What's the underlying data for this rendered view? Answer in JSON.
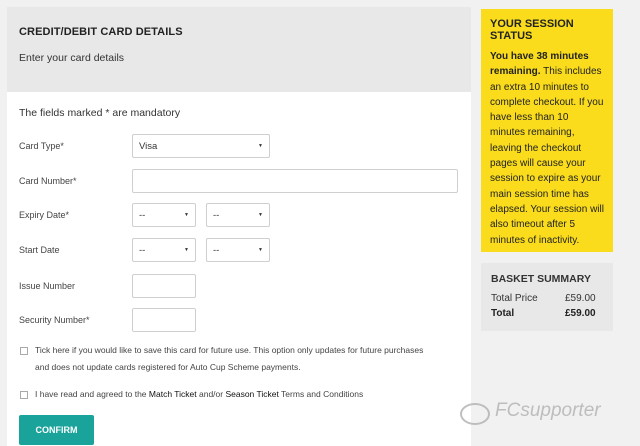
{
  "card": {
    "title": "CREDIT/DEBIT CARD DETAILS",
    "subtitle": "Enter your card details",
    "mandatory_note": "The fields marked * are mandatory",
    "card_type_label": "Card Type*",
    "card_type_value": "Visa",
    "card_number_label": "Card Number*",
    "expiry_label": "Expiry Date*",
    "expiry_month": "--",
    "expiry_year": "--",
    "start_label": "Start Date",
    "start_month": "--",
    "start_year": "--",
    "issue_label": "Issue Number",
    "security_label": "Security Number*",
    "save_card_text_line1": "Tick here if you would like to save this card for future use. This option only updates for future purchases",
    "save_card_text_line2": "and does not update cards registered for Auto Cup Scheme payments.",
    "terms_prefix": "I have read and agreed to the ",
    "terms_link1": "Match Ticket",
    "terms_mid": " and/or ",
    "terms_link2": "Season Ticket",
    "terms_suffix": " Terms and Conditions",
    "confirm_label": "CONFIRM"
  },
  "session": {
    "title": "YOUR SESSION STATUS",
    "bold_text": "You have 38 minutes remaining.",
    "body_text": " This includes an extra 10 minutes to complete checkout. If you have less than 10 minutes remaining, leaving the checkout pages will cause your session to expire as your main session time has elapsed. Your session will also timeout after 5 minutes of inactivity."
  },
  "basket": {
    "title": "BASKET SUMMARY",
    "total_price_label": "Total Price",
    "total_price_value": "£59.00",
    "total_label": "Total",
    "total_value": "£59.00"
  },
  "watermark": "FCsupporter",
  "colors": {
    "session_bg": "#fadc1c",
    "confirm_bg": "#1aa39a",
    "panel_bg": "#e8e8e8"
  },
  "icons": {
    "dropdown": "caret-down-icon",
    "watermark": "wechat-icon"
  }
}
